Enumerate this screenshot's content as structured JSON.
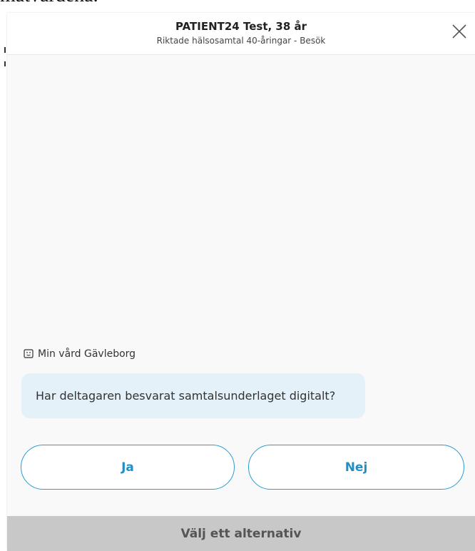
{
  "background": {
    "partial_text": "matvärdena."
  },
  "header": {
    "title": "PATIENT24 Test, 38 år",
    "subtitle": "Riktade hälsosamtal 40-åringar - Besök",
    "close_icon": "close-icon"
  },
  "chat": {
    "sender": "Min vård Gävleborg",
    "sender_icon": "chat-bot-icon",
    "message": "Har deltagaren besvarat samtalsunderlaget digitalt?"
  },
  "choices": [
    {
      "label": "Ja"
    },
    {
      "label": "Nej"
    }
  ],
  "footer": {
    "label": "Välj ett alternativ"
  },
  "colors": {
    "accent": "#2a9bd3",
    "bubble_bg": "#e4f1f9",
    "footer_bg": "#c8c8c8"
  }
}
